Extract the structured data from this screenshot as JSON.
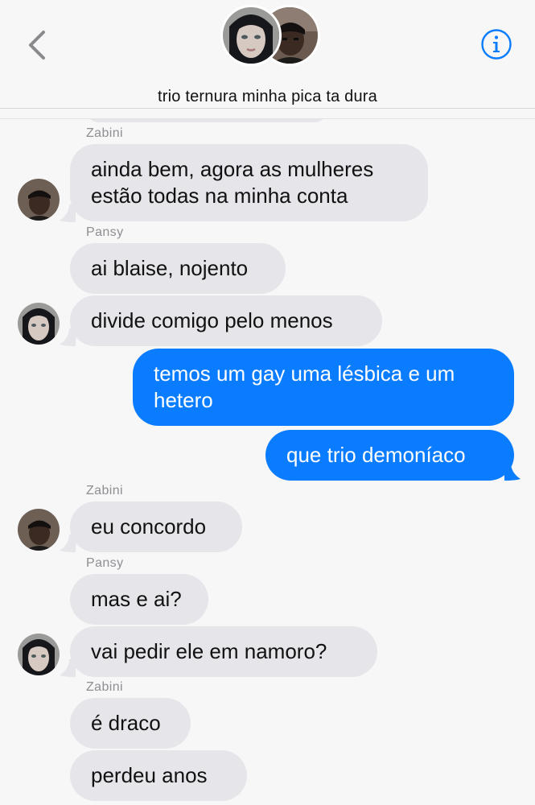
{
  "header": {
    "title": "trio ternura minha pica ta dura",
    "back_icon": "chevron-left-icon",
    "info_icon": "info-icon"
  },
  "colors": {
    "accent": "#0a7cff",
    "incoming_bubble": "#e5e5ea",
    "sender_label": "#8e8e93",
    "background": "#f7f7f7"
  },
  "messages": [
    {
      "sender": "Zabini"
    },
    {
      "text": "ainda bem, agora as mulheres estão todas na minha conta"
    },
    {
      "sender": "Pansy"
    },
    {
      "text": "ai blaise, nojento"
    },
    {
      "text": "divide comigo pelo menos"
    },
    {
      "text": "temos um gay uma lésbica e um hetero"
    },
    {
      "text": "que trio demoníaco"
    },
    {
      "sender": "Zabini"
    },
    {
      "text": "eu concordo"
    },
    {
      "sender": "Pansy"
    },
    {
      "text": "mas e ai?"
    },
    {
      "text": "vai pedir ele em namoro?"
    },
    {
      "sender": "Zabini"
    },
    {
      "text": "é draco"
    },
    {
      "text": "perdeu anos"
    }
  ]
}
